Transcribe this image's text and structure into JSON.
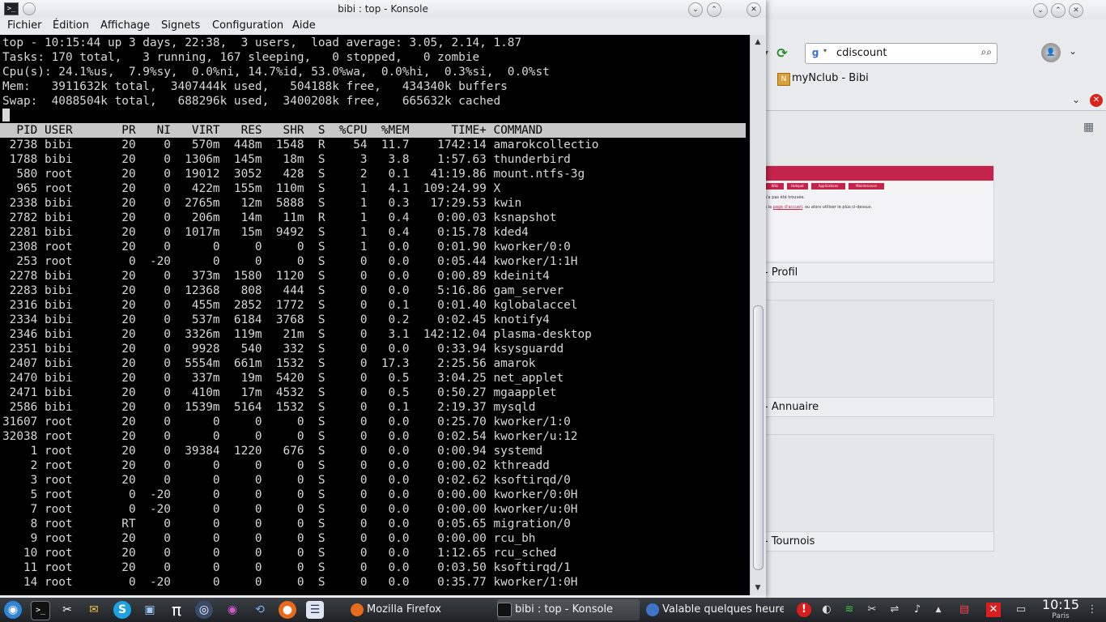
{
  "firefox": {
    "search_engine_label": "g",
    "search_value": "cdiscount",
    "bookmark_label": "myNclub - Bibi",
    "thumbnail": {
      "nav_items": [
        "Wiki",
        "Hotspot",
        "Applications",
        "Maintenance"
      ],
      "line1": "n'a pas été trouvée.",
      "line2_prefix": "à la ",
      "line2_link": "page d'accueil",
      "line2_suffix": ", ou alors utiliser le plus ci-dessus."
    },
    "cards": [
      "- Profil",
      "- Annuaire",
      "- Tournois"
    ]
  },
  "konsole": {
    "title": "bibi : top - Konsole",
    "menu": [
      "Fichier",
      "Édition",
      "Affichage",
      "Signets",
      "Configuration",
      "Aide"
    ],
    "header_lines": [
      "top - 10:15:44 up 3 days, 22:38,  3 users,  load average: 3.05, 2.14, 1.87",
      "Tasks: 170 total,   3 running, 167 sleeping,   0 stopped,   0 zombie",
      "Cpu(s): 24.1%us,  7.9%sy,  0.0%ni, 14.7%id, 53.0%wa,  0.0%hi,  0.3%si,  0.0%st",
      "Mem:   3911632k total,  3407444k used,   504188k free,   434340k buffers",
      "Swap:  4088504k total,   688296k used,  3400208k free,   665632k cached"
    ],
    "columns": [
      "PID",
      "USER",
      "PR",
      "NI",
      "VIRT",
      "RES",
      "SHR",
      "S",
      "%CPU",
      "%MEM",
      "TIME+",
      "COMMAND"
    ],
    "processes": [
      [
        "2738",
        "bibi",
        "20",
        "0",
        "570m",
        "448m",
        "1548",
        "R",
        "54",
        "11.7",
        "1742:14",
        "amarokcollectio"
      ],
      [
        "1788",
        "bibi",
        "20",
        "0",
        "1306m",
        "145m",
        "18m",
        "S",
        "3",
        "3.8",
        "1:57.63",
        "thunderbird"
      ],
      [
        "580",
        "root",
        "20",
        "0",
        "19012",
        "3052",
        "428",
        "S",
        "2",
        "0.1",
        "41:19.86",
        "mount.ntfs-3g"
      ],
      [
        "965",
        "root",
        "20",
        "0",
        "422m",
        "155m",
        "110m",
        "S",
        "1",
        "4.1",
        "109:24.99",
        "X"
      ],
      [
        "2338",
        "bibi",
        "20",
        "0",
        "2765m",
        "12m",
        "5888",
        "S",
        "1",
        "0.3",
        "17:29.53",
        "kwin"
      ],
      [
        "2782",
        "bibi",
        "20",
        "0",
        "206m",
        "14m",
        "11m",
        "R",
        "1",
        "0.4",
        "0:00.03",
        "ksnapshot"
      ],
      [
        "2281",
        "bibi",
        "20",
        "0",
        "1017m",
        "15m",
        "9492",
        "S",
        "1",
        "0.4",
        "0:15.78",
        "kded4"
      ],
      [
        "2308",
        "root",
        "20",
        "0",
        "0",
        "0",
        "0",
        "S",
        "1",
        "0.0",
        "0:01.90",
        "kworker/0:0"
      ],
      [
        "253",
        "root",
        "0",
        "-20",
        "0",
        "0",
        "0",
        "S",
        "0",
        "0.0",
        "0:05.44",
        "kworker/1:1H"
      ],
      [
        "2278",
        "bibi",
        "20",
        "0",
        "373m",
        "1580",
        "1120",
        "S",
        "0",
        "0.0",
        "0:00.89",
        "kdeinit4"
      ],
      [
        "2283",
        "bibi",
        "20",
        "0",
        "12368",
        "808",
        "444",
        "S",
        "0",
        "0.0",
        "5:16.86",
        "gam_server"
      ],
      [
        "2316",
        "bibi",
        "20",
        "0",
        "455m",
        "2852",
        "1772",
        "S",
        "0",
        "0.1",
        "0:01.40",
        "kglobalaccel"
      ],
      [
        "2334",
        "bibi",
        "20",
        "0",
        "537m",
        "6184",
        "3768",
        "S",
        "0",
        "0.2",
        "0:02.45",
        "knotify4"
      ],
      [
        "2346",
        "bibi",
        "20",
        "0",
        "3326m",
        "119m",
        "21m",
        "S",
        "0",
        "3.1",
        "142:12.04",
        "plasma-desktop"
      ],
      [
        "2351",
        "bibi",
        "20",
        "0",
        "9928",
        "540",
        "332",
        "S",
        "0",
        "0.0",
        "0:33.94",
        "ksysguardd"
      ],
      [
        "2407",
        "bibi",
        "20",
        "0",
        "5554m",
        "661m",
        "1532",
        "S",
        "0",
        "17.3",
        "2:25.56",
        "amarok"
      ],
      [
        "2470",
        "bibi",
        "20",
        "0",
        "337m",
        "19m",
        "5420",
        "S",
        "0",
        "0.5",
        "3:04.25",
        "net_applet"
      ],
      [
        "2471",
        "bibi",
        "20",
        "0",
        "410m",
        "17m",
        "4532",
        "S",
        "0",
        "0.5",
        "0:50.27",
        "mgaapplet"
      ],
      [
        "2586",
        "bibi",
        "20",
        "0",
        "1539m",
        "5164",
        "1532",
        "S",
        "0",
        "0.1",
        "2:19.37",
        "mysqld"
      ],
      [
        "31607",
        "root",
        "20",
        "0",
        "0",
        "0",
        "0",
        "S",
        "0",
        "0.0",
        "0:25.70",
        "kworker/1:0"
      ],
      [
        "32038",
        "root",
        "20",
        "0",
        "0",
        "0",
        "0",
        "S",
        "0",
        "0.0",
        "0:02.54",
        "kworker/u:12"
      ],
      [
        "1",
        "root",
        "20",
        "0",
        "39384",
        "1220",
        "676",
        "S",
        "0",
        "0.0",
        "0:00.94",
        "systemd"
      ],
      [
        "2",
        "root",
        "20",
        "0",
        "0",
        "0",
        "0",
        "S",
        "0",
        "0.0",
        "0:00.02",
        "kthreadd"
      ],
      [
        "3",
        "root",
        "20",
        "0",
        "0",
        "0",
        "0",
        "S",
        "0",
        "0.0",
        "0:02.62",
        "ksoftirqd/0"
      ],
      [
        "5",
        "root",
        "0",
        "-20",
        "0",
        "0",
        "0",
        "S",
        "0",
        "0.0",
        "0:00.00",
        "kworker/0:0H"
      ],
      [
        "7",
        "root",
        "0",
        "-20",
        "0",
        "0",
        "0",
        "S",
        "0",
        "0.0",
        "0:00.00",
        "kworker/u:0H"
      ],
      [
        "8",
        "root",
        "RT",
        "0",
        "0",
        "0",
        "0",
        "S",
        "0",
        "0.0",
        "0:05.65",
        "migration/0"
      ],
      [
        "9",
        "root",
        "20",
        "0",
        "0",
        "0",
        "0",
        "S",
        "0",
        "0.0",
        "0:00.00",
        "rcu_bh"
      ],
      [
        "10",
        "root",
        "20",
        "0",
        "0",
        "0",
        "0",
        "S",
        "0",
        "0.0",
        "1:12.65",
        "rcu_sched"
      ],
      [
        "11",
        "root",
        "20",
        "0",
        "0",
        "0",
        "0",
        "S",
        "0",
        "0.0",
        "0:03.50",
        "ksoftirqd/1"
      ],
      [
        "14",
        "root",
        "0",
        "-20",
        "0",
        "0",
        "0",
        "S",
        "0",
        "0.0",
        "0:35.77",
        "kworker/1:0H"
      ]
    ]
  },
  "taskbar": {
    "tasks": [
      "Mozilla Firefox",
      "bibi : top - Konsole",
      "Valable quelques heure"
    ],
    "clock_time": "10:15",
    "clock_zone": "Paris",
    "icons": [
      "mandriva-icon",
      "terminal-icon",
      "tools-icon",
      "mail-icon",
      "skype-icon",
      "network-icon",
      "pi-icon",
      "search-icon",
      "eye-icon",
      "update-icon",
      "firefox-icon",
      "document-icon"
    ],
    "tray_icons": [
      "alert-icon",
      "dolphin-icon",
      "wifi-icon",
      "scissors-icon",
      "usb-icon",
      "volume-icon",
      "chevron-up-icon",
      "calendar-icon",
      "close-icon",
      "monitor-icon"
    ]
  },
  "colors": {
    "terminal_bg": "#000000",
    "terminal_fg": "#d8d8d8",
    "header_row_bg": "#c8c8c8",
    "thumbnail_accent": "#c4244b"
  }
}
